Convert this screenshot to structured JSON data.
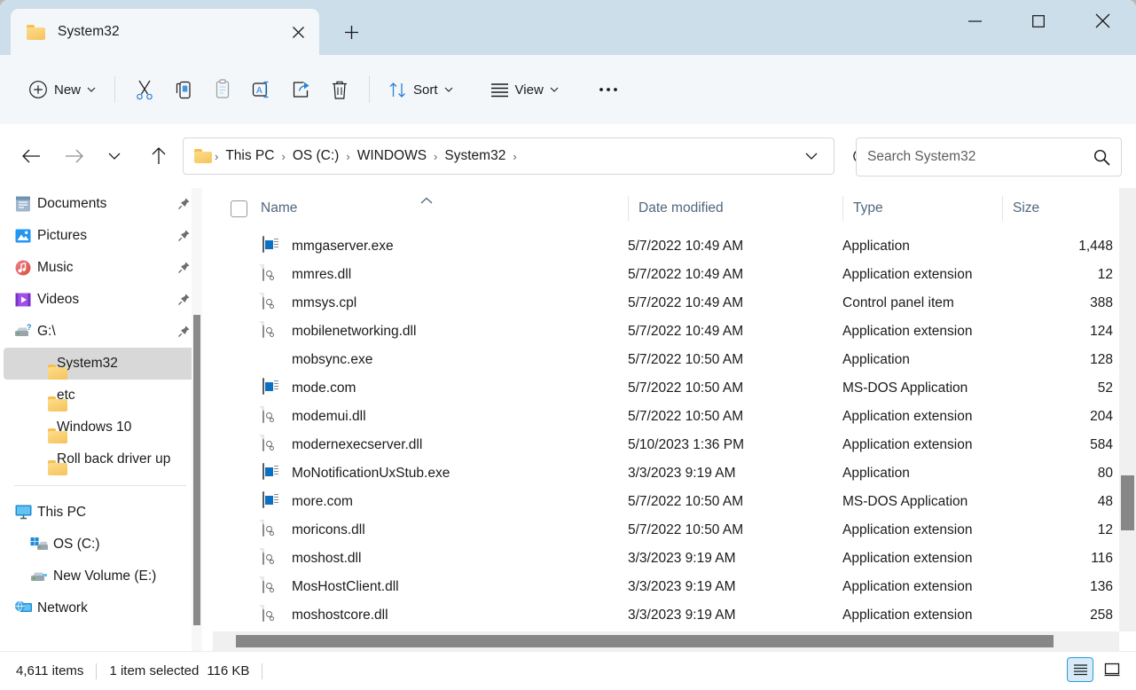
{
  "window": {
    "tab_title": "System32",
    "controls": {
      "minimize": "minimize-icon",
      "maximize": "maximize-icon",
      "close": "close-icon"
    },
    "new_tab_label": "+"
  },
  "toolbar": {
    "new_label": "New",
    "sort_label": "Sort",
    "view_label": "View",
    "more_label": "•••",
    "icons": [
      "plus-circle-icon",
      "cut-icon",
      "copy-icon",
      "paste-icon",
      "rename-icon",
      "share-icon",
      "delete-icon",
      "sort-icon",
      "view-icon",
      "more-icon"
    ]
  },
  "address": {
    "back": "back-arrow-icon",
    "forward": "forward-arrow-icon",
    "recent": "chevron-down-icon",
    "up": "up-arrow-icon",
    "crumbs": [
      "This PC",
      "OS (C:)",
      "WINDOWS",
      "System32"
    ],
    "separator": "›",
    "dropdown": "chevron-down-icon",
    "refresh": "refresh-icon"
  },
  "search": {
    "placeholder": "Search System32",
    "value": "",
    "icon": "search-icon"
  },
  "sidebar": {
    "items": [
      {
        "label": "Documents",
        "icon": "documents-icon",
        "pinned": true,
        "indent": 0,
        "selected": false
      },
      {
        "label": "Pictures",
        "icon": "pictures-icon",
        "pinned": true,
        "indent": 0,
        "selected": false
      },
      {
        "label": "Music",
        "icon": "music-icon",
        "pinned": true,
        "indent": 0,
        "selected": false
      },
      {
        "label": "Videos",
        "icon": "videos-icon",
        "pinned": true,
        "indent": 0,
        "selected": false
      },
      {
        "label": "G:\\",
        "icon": "drive-icon",
        "pinned": true,
        "indent": 0,
        "selected": false
      },
      {
        "label": "System32",
        "icon": "folder-icon",
        "pinned": false,
        "indent": 0,
        "selected": true
      },
      {
        "label": "etc",
        "icon": "folder-icon",
        "pinned": false,
        "indent": 0,
        "selected": false
      },
      {
        "label": "Windows 10",
        "icon": "folder-icon",
        "pinned": false,
        "indent": 0,
        "selected": false
      },
      {
        "label": "Roll back driver up",
        "icon": "folder-icon",
        "pinned": false,
        "indent": 0,
        "selected": false
      }
    ],
    "items2": [
      {
        "label": "This PC",
        "icon": "this-pc-icon",
        "indent": 0
      },
      {
        "label": "OS (C:)",
        "icon": "os-drive-icon",
        "indent": 1
      },
      {
        "label": "New Volume (E:)",
        "icon": "drive-icon",
        "indent": 1
      },
      {
        "label": "Network",
        "icon": "network-icon",
        "indent": 0
      }
    ]
  },
  "filelist": {
    "columns": [
      "Name",
      "Date modified",
      "Type",
      "Size"
    ],
    "sort_column": "Name",
    "sort_direction": "ascending",
    "rows": [
      {
        "name": "mmgaserver.exe",
        "icon": "exe-icon",
        "date": "5/7/2022 10:49 AM",
        "type": "Application",
        "size": "1,448 "
      },
      {
        "name": "mmres.dll",
        "icon": "dll-icon",
        "date": "5/7/2022 10:49 AM",
        "type": "Application extension",
        "size": "12 "
      },
      {
        "name": "mmsys.cpl",
        "icon": "dll-icon",
        "date": "5/7/2022 10:49 AM",
        "type": "Control panel item",
        "size": "388 "
      },
      {
        "name": "mobilenetworking.dll",
        "icon": "dll-icon",
        "date": "5/7/2022 10:49 AM",
        "type": "Application extension",
        "size": "124 "
      },
      {
        "name": "mobsync.exe",
        "icon": "sync-icon",
        "date": "5/7/2022 10:50 AM",
        "type": "Application",
        "size": "128 "
      },
      {
        "name": "mode.com",
        "icon": "exe-icon",
        "date": "5/7/2022 10:50 AM",
        "type": "MS-DOS Application",
        "size": "52 "
      },
      {
        "name": "modemui.dll",
        "icon": "dll-icon",
        "date": "5/7/2022 10:50 AM",
        "type": "Application extension",
        "size": "204 "
      },
      {
        "name": "modernexecserver.dll",
        "icon": "dll-icon",
        "date": "5/10/2023 1:36 PM",
        "type": "Application extension",
        "size": "584 "
      },
      {
        "name": "MoNotificationUxStub.exe",
        "icon": "exe-icon",
        "date": "3/3/2023 9:19 AM",
        "type": "Application",
        "size": "80 "
      },
      {
        "name": "more.com",
        "icon": "exe-icon",
        "date": "5/7/2022 10:50 AM",
        "type": "MS-DOS Application",
        "size": "48 "
      },
      {
        "name": "moricons.dll",
        "icon": "dll-icon",
        "date": "5/7/2022 10:50 AM",
        "type": "Application extension",
        "size": "12 "
      },
      {
        "name": "moshost.dll",
        "icon": "dll-icon",
        "date": "3/3/2023 9:19 AM",
        "type": "Application extension",
        "size": "116 "
      },
      {
        "name": "MosHostClient.dll",
        "icon": "dll-icon",
        "date": "3/3/2023 9:19 AM",
        "type": "Application extension",
        "size": "136 "
      },
      {
        "name": "moshostcore.dll",
        "icon": "dll-icon",
        "date": "3/3/2023 9:19 AM",
        "type": "Application extension",
        "size": "258 "
      }
    ]
  },
  "statusbar": {
    "item_count": "4,611 items",
    "selection": "1 item selected",
    "selection_size": "116 KB",
    "view_details": "details-view-icon",
    "view_large": "large-icons-view-icon",
    "active_view": "details"
  },
  "colors": {
    "titlebar": "#cddeeb",
    "toolbar": "#f3f7fa",
    "accent": "#0b6fc4",
    "header_text": "#51667d",
    "selection": "#d8d8d8",
    "folder": "#f6c25b"
  }
}
